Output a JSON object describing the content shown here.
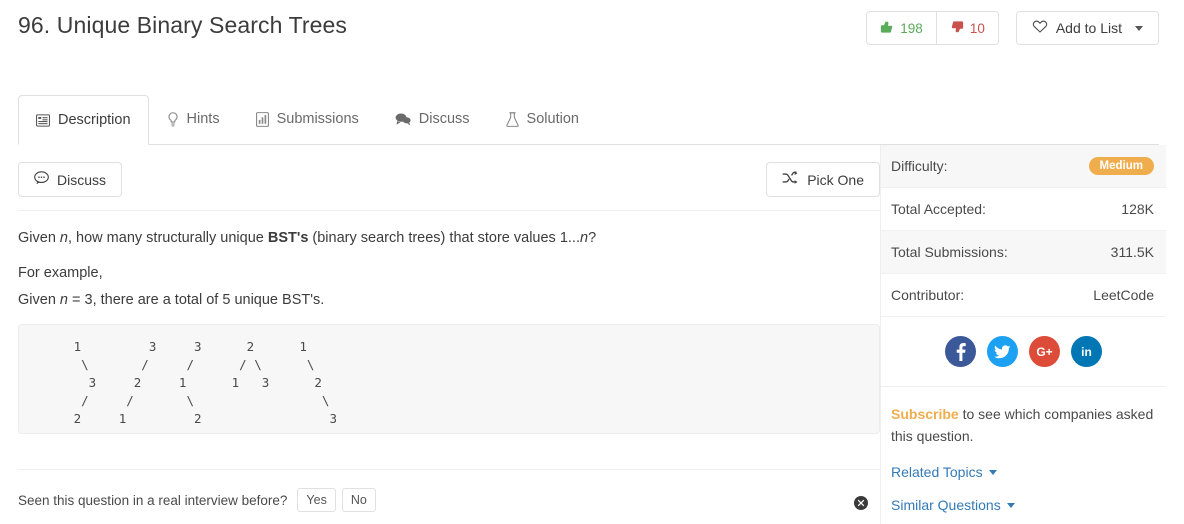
{
  "header": {
    "title": "96. Unique Binary Search Trees",
    "upvotes": "198",
    "downvotes": "10",
    "add_to_list_label": "Add to List"
  },
  "tabs": [
    {
      "label": "Description",
      "icon": "description-icon",
      "active": true
    },
    {
      "label": "Hints",
      "icon": "lightbulb-icon",
      "active": false
    },
    {
      "label": "Submissions",
      "icon": "submissions-icon",
      "active": false
    },
    {
      "label": "Discuss",
      "icon": "chat-icon",
      "active": false
    },
    {
      "label": "Solution",
      "icon": "flask-icon",
      "active": false
    }
  ],
  "toolbar": {
    "discuss_label": "Discuss",
    "pick_one_label": "Pick One"
  },
  "question": {
    "line1_a": "Given ",
    "line1_n": "n",
    "line1_b": ", how many structurally unique ",
    "line1_bold": "BST's",
    "line1_c": " (binary search trees) that store values 1...",
    "line1_n2": "n",
    "line1_d": "?",
    "line2": "For example,",
    "line3_a": "Given ",
    "line3_n": "n",
    "line3_b": " = 3, there are a total of 5 unique BST's.",
    "code": "   1         3     3      2      1\n    \\       /     /      / \\      \\\n     3     2     1      1   3      2\n    /     /       \\                 \\\n   2     1         2                 3"
  },
  "interview": {
    "prompt": "Seen this question in a real interview before?",
    "yes_label": "Yes",
    "no_label": "No",
    "report_icon": "report-icon"
  },
  "sidebar": {
    "stats": [
      {
        "label": "Difficulty:",
        "value": "Medium",
        "badge": true
      },
      {
        "label": "Total Accepted:",
        "value": "128K",
        "badge": false
      },
      {
        "label": "Total Submissions:",
        "value": "311.5K",
        "badge": false
      },
      {
        "label": "Contributor:",
        "value": "LeetCode",
        "badge": false
      }
    ],
    "social": [
      {
        "name": "facebook-icon",
        "glyph": "f",
        "color": "#3b5998"
      },
      {
        "name": "twitter-icon",
        "glyph": "t",
        "color": "#1da1f2"
      },
      {
        "name": "googleplus-icon",
        "glyph": "G+",
        "color": "#dd4b39"
      },
      {
        "name": "linkedin-icon",
        "glyph": "in",
        "color": "#0077b5"
      }
    ],
    "subscribe_link": "Subscribe",
    "subscribe_text": " to see which companies asked this question.",
    "related_topics": "Related Topics",
    "similar_questions": "Similar Questions"
  },
  "colors": {
    "accent_blue": "#337ab7",
    "medium_orange": "#f0ad4e",
    "upvote_green": "#5aab5a",
    "downvote_red": "#c9524f"
  }
}
